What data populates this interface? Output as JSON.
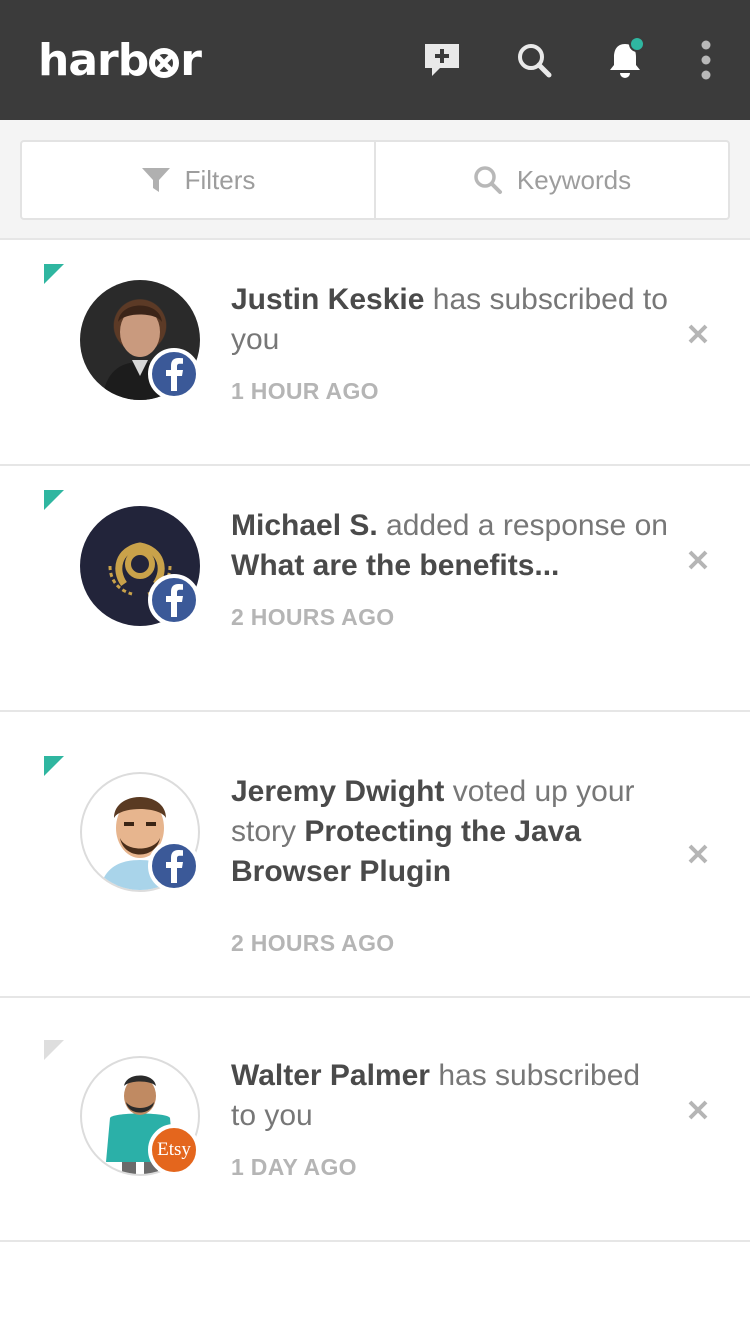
{
  "app": {
    "logo_text_left": "harb",
    "logo_text_right": "r"
  },
  "header": {
    "icons": [
      "compose-icon",
      "search-icon",
      "bell-icon",
      "more-icon"
    ],
    "notification_dot_color": "#2fb6a0"
  },
  "filters": {
    "filters_label": "Filters",
    "keywords_label": "Keywords"
  },
  "colors": {
    "topbar": "#3b3b3b",
    "accent": "#2fb6a0",
    "facebook": "#3b5998",
    "etsy": "#e4661d"
  },
  "notifications": [
    {
      "unread": true,
      "actor": "Justin Keskie",
      "action": " has subscribed to you",
      "time": "1 HOUR AGO",
      "source": "facebook",
      "avatar": "photo-avatar"
    },
    {
      "unread": true,
      "actor": "Michael S.",
      "action": " added a response on ",
      "target": "What are the benefits...",
      "time": "2 HOURS AGO",
      "source": "facebook",
      "avatar": "laurel-logo-avatar"
    },
    {
      "unread": true,
      "actor": "Jeremy Dwight",
      "action": " voted up your story ",
      "target": "Protecting the Java Browser Plugin",
      "time": "2 HOURS AGO",
      "source": "facebook",
      "avatar": "cartoon-avatar"
    },
    {
      "unread": false,
      "actor": "Walter Palmer",
      "action": " has subscribed to you",
      "time": "1 DAY AGO",
      "source": "etsy",
      "source_label": "Etsy",
      "avatar": "cartoon-avatar"
    }
  ]
}
